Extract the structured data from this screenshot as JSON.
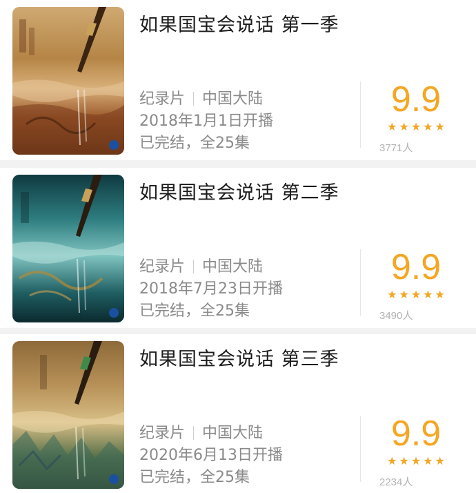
{
  "items": [
    {
      "title": "如果国宝会说话 第一季",
      "genre": "纪录片",
      "region": "中国大陆",
      "release": "2018年1月1日开播",
      "status": "已完结，全25集",
      "score": "9.9",
      "rating_count": "3771人",
      "stars": 5,
      "poster_theme": "amber"
    },
    {
      "title": "如果国宝会说话 第二季",
      "genre": "纪录片",
      "region": "中国大陆",
      "release": "2018年7月23日开播",
      "status": "已完结，全25集",
      "score": "9.9",
      "rating_count": "3490人",
      "stars": 5,
      "poster_theme": "teal"
    },
    {
      "title": "如果国宝会说话 第三季",
      "genre": "纪录片",
      "region": "中国大陆",
      "release": "2020年6月13日开播",
      "status": "已完结，全25集",
      "score": "9.9",
      "rating_count": "2234人",
      "stars": 5,
      "poster_theme": "olive"
    }
  ],
  "colors": {
    "accent": "#f5a623",
    "title_text": "#1c1c1c",
    "meta_text": "#8a8a8a",
    "count_text": "#b2b2b2"
  }
}
